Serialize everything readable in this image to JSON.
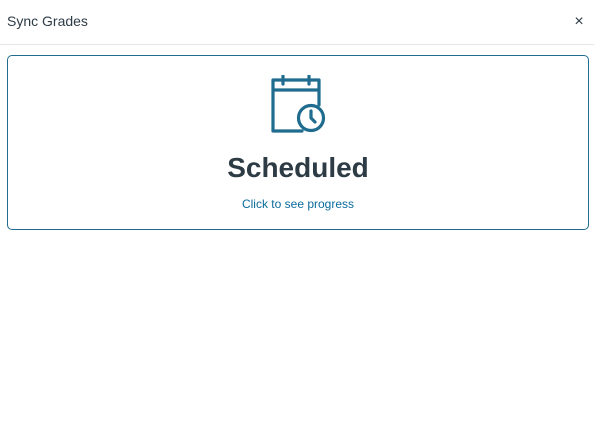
{
  "dialog": {
    "title": "Sync Grades",
    "close_label": "×"
  },
  "status": {
    "icon": "calendar-clock-icon",
    "title": "Scheduled",
    "link_text": "Click to see progress",
    "accent_color": "#1f6c8f"
  }
}
